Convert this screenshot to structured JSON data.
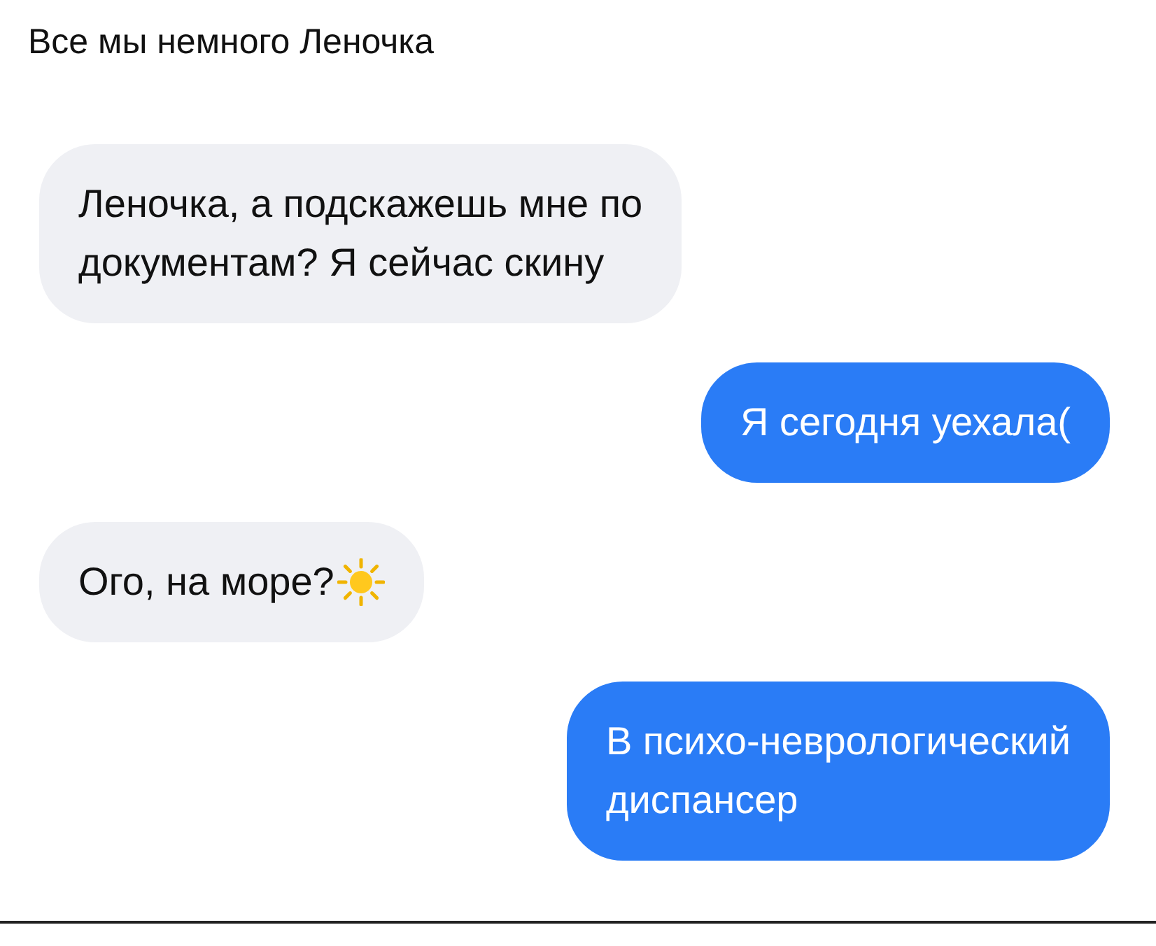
{
  "title": "Все мы немного Леночка",
  "messages": [
    {
      "kind": "incoming",
      "text": "Леночка, а подскажешь мне по\nдокументам? Я сейчас скину"
    },
    {
      "kind": "outgoing",
      "text": "Я сегодня уехала("
    },
    {
      "kind": "incoming",
      "text": "Ого, на море?",
      "with_icon": true
    },
    {
      "kind": "outgoing",
      "text": "В психо-неврологический\nдиспансер"
    }
  ]
}
